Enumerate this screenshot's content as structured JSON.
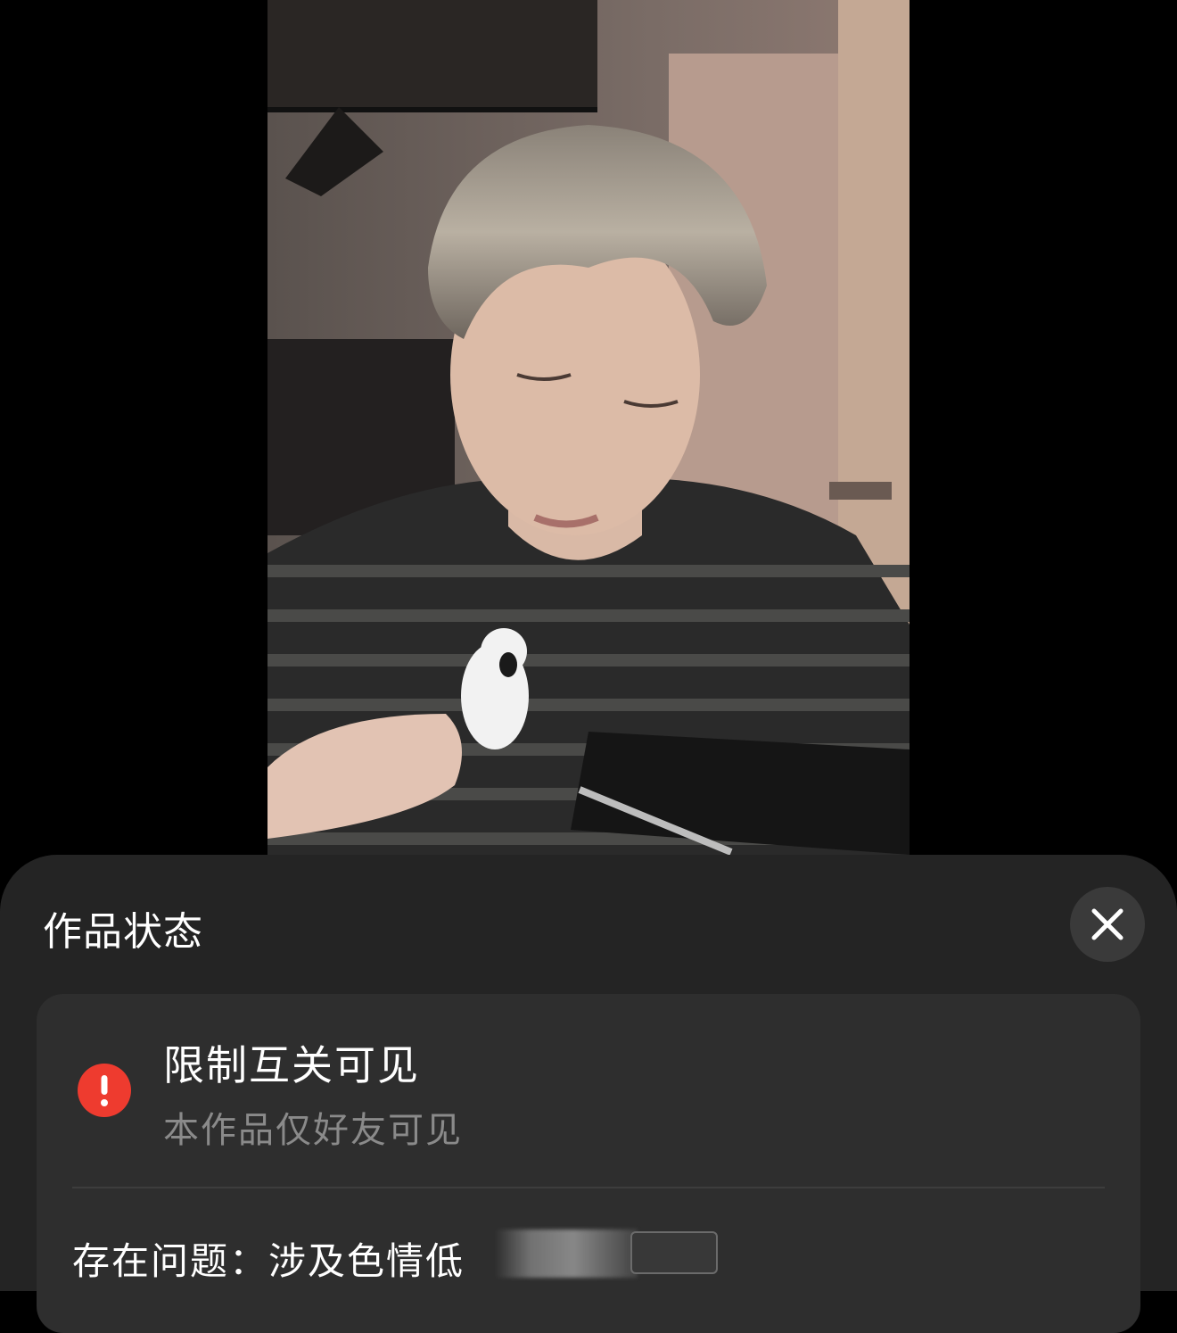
{
  "sheet": {
    "title": "作品状态",
    "close_icon": "close-icon"
  },
  "status": {
    "icon": "warning-icon",
    "icon_color": "#ee3b2f",
    "title": "限制互关可见",
    "description": "本作品仅好友可见"
  },
  "issue": {
    "label": "存在问题：",
    "text": "涉及色情低"
  }
}
